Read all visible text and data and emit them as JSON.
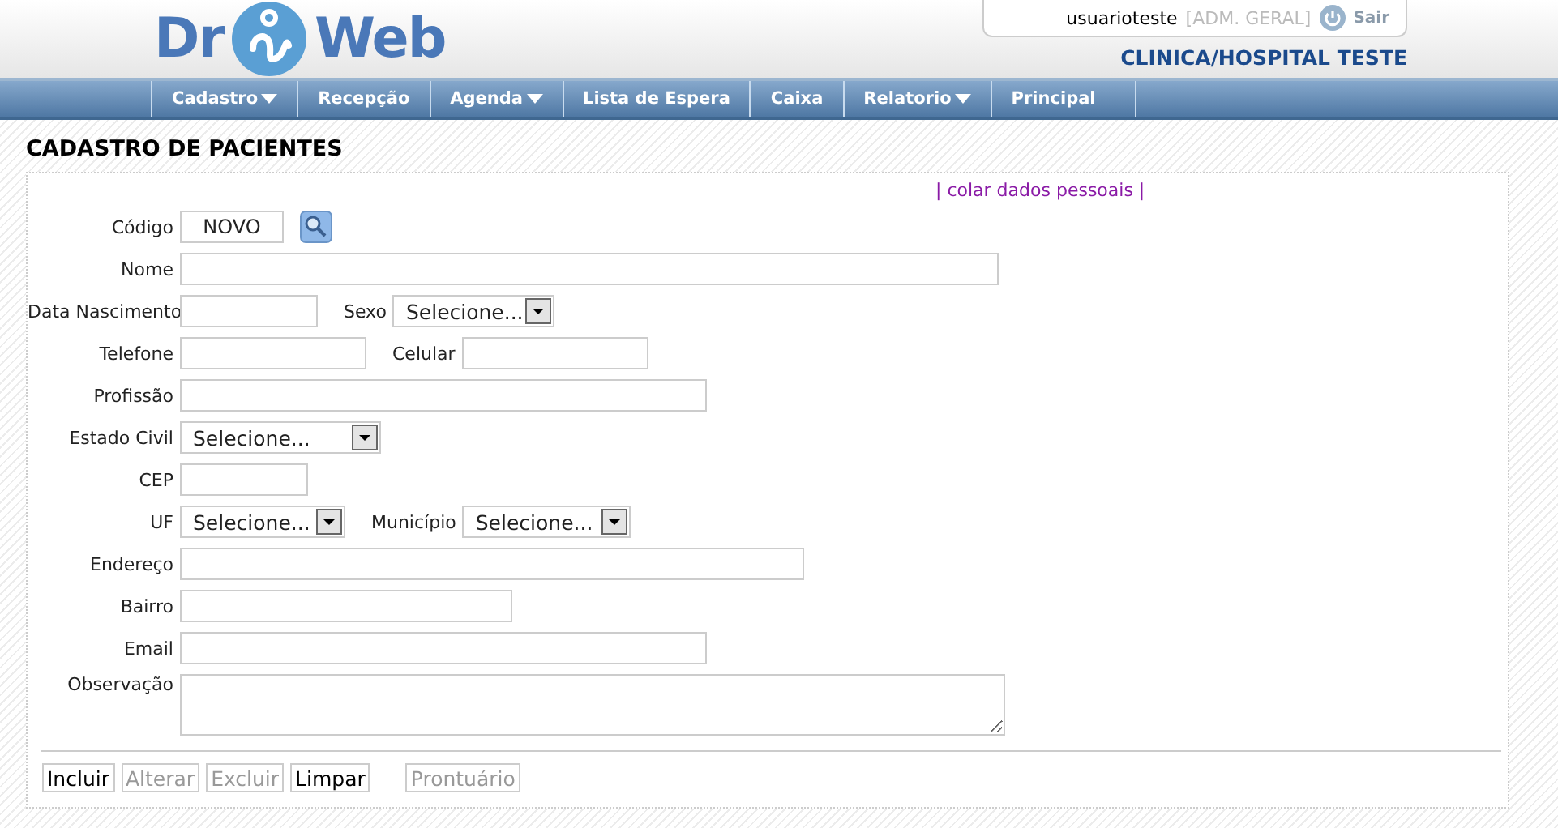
{
  "header": {
    "logo_left": "Dr",
    "logo_right": "Web",
    "username": "usuarioteste",
    "role": "[ADM. GERAL]",
    "logout": "Sair",
    "clinic": "CLINICA/HOSPITAL TESTE"
  },
  "nav": [
    {
      "label": "Cadastro",
      "dropdown": true
    },
    {
      "label": "Recepção",
      "dropdown": false
    },
    {
      "label": "Agenda",
      "dropdown": true
    },
    {
      "label": "Lista de Espera",
      "dropdown": false
    },
    {
      "label": "Caixa",
      "dropdown": false
    },
    {
      "label": "Relatorio",
      "dropdown": true
    },
    {
      "label": "Principal",
      "dropdown": false
    }
  ],
  "page_title": "CADASTRO DE PACIENTES",
  "paste_link": "| colar dados pessoais |",
  "form_rows": [
    {
      "fields": [
        {
          "label": "Código",
          "kind": "code",
          "value": "NOVO"
        }
      ]
    },
    {
      "fields": [
        {
          "label": "Nome",
          "kind": "text"
        }
      ]
    },
    {
      "fields": [
        {
          "label": "Data Nascimento",
          "kind": "text"
        },
        {
          "label": "Sexo",
          "kind": "select",
          "value": "Selecione..."
        }
      ]
    },
    {
      "fields": [
        {
          "label": "Telefone",
          "kind": "text"
        },
        {
          "label": "Celular",
          "kind": "text"
        }
      ]
    },
    {
      "fields": [
        {
          "label": "Profissão",
          "kind": "text"
        }
      ]
    },
    {
      "fields": [
        {
          "label": "Estado Civil",
          "kind": "select",
          "value": "Selecione..."
        }
      ]
    },
    {
      "fields": [
        {
          "label": "CEP",
          "kind": "text"
        }
      ]
    },
    {
      "fields": [
        {
          "label": "UF",
          "kind": "select",
          "value": "Selecione..."
        },
        {
          "label": "Município",
          "kind": "select",
          "value": "Selecione..."
        }
      ]
    },
    {
      "fields": [
        {
          "label": "Endereço",
          "kind": "text"
        }
      ]
    },
    {
      "fields": [
        {
          "label": "Bairro",
          "kind": "text"
        }
      ]
    },
    {
      "fields": [
        {
          "label": "Email",
          "kind": "text"
        }
      ]
    },
    {
      "fields": [
        {
          "label": "Observação",
          "kind": "textarea"
        }
      ]
    }
  ],
  "buttons": [
    {
      "label": "Incluir",
      "disabled": false
    },
    {
      "label": "Alterar",
      "disabled": true
    },
    {
      "label": "Excluir",
      "disabled": true
    },
    {
      "label": "Limpar",
      "disabled": false
    },
    {
      "label": "Prontuário",
      "disabled": true
    }
  ]
}
